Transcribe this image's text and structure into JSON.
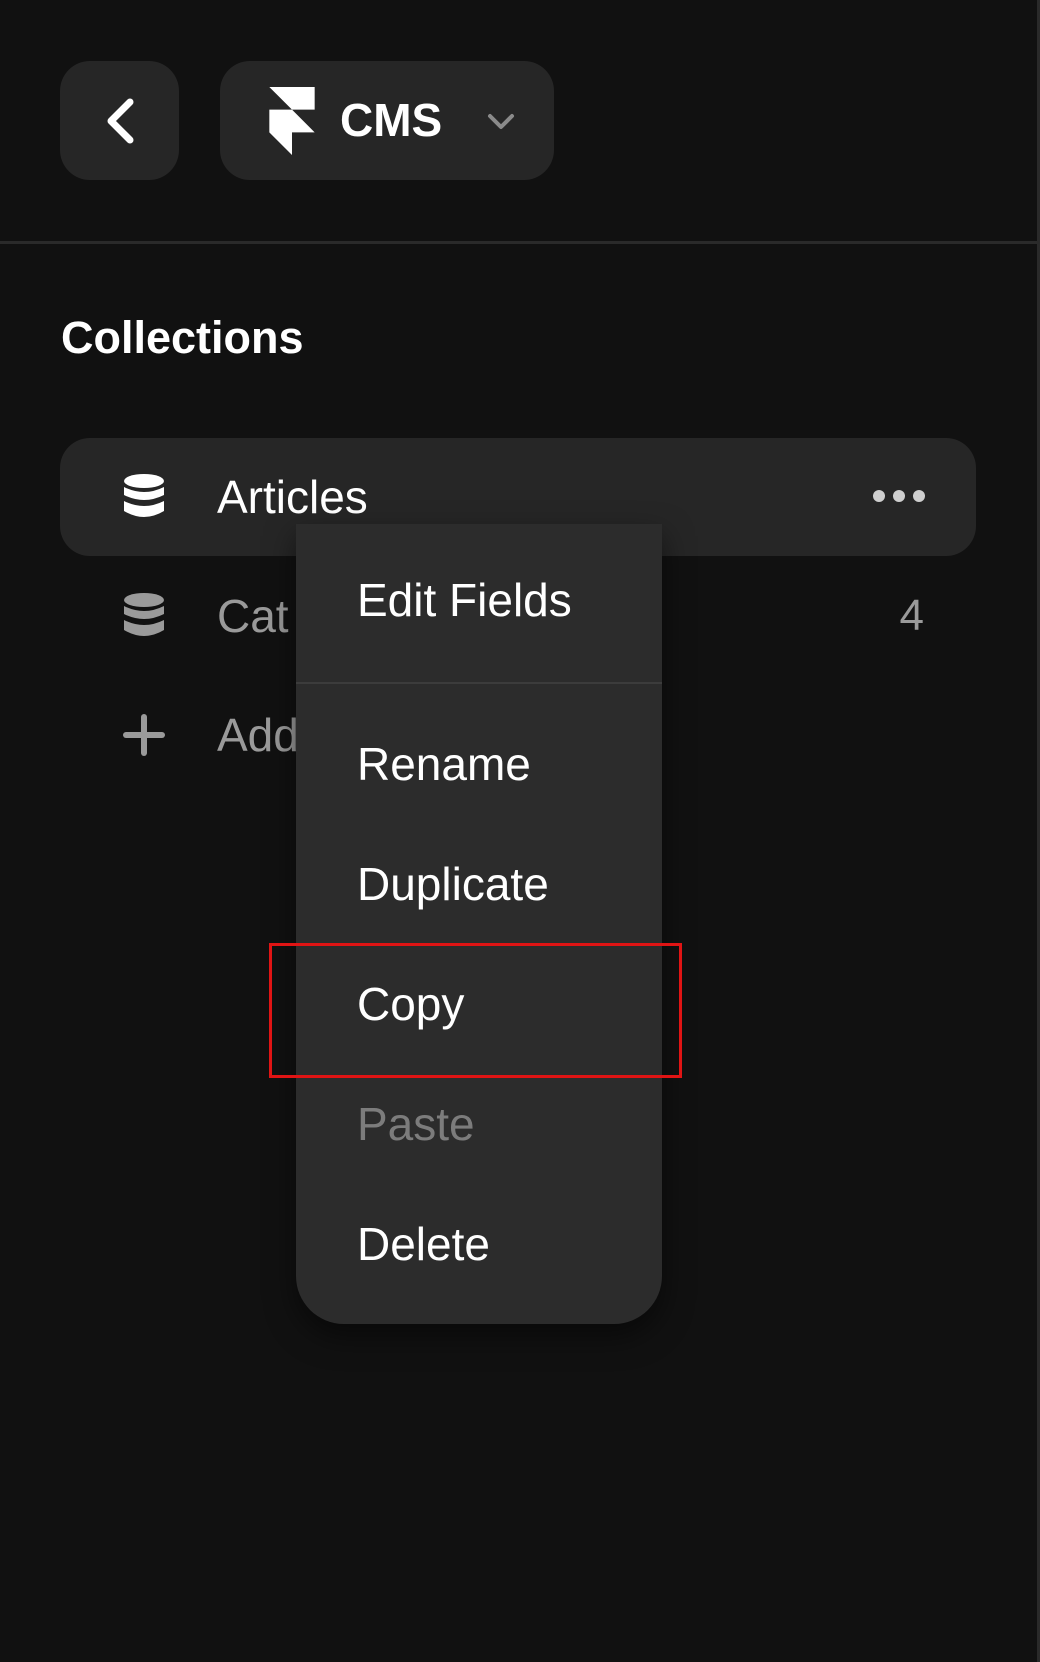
{
  "header": {
    "back_icon": "chevron-left-icon",
    "project": {
      "logo_icon": "framer-logo-icon",
      "label": "CMS",
      "dropdown_icon": "chevron-down-icon"
    }
  },
  "collections": {
    "title": "Collections",
    "items": [
      {
        "label": "Articles",
        "icon": "database-icon",
        "action_icon": "more-horizontal-icon",
        "active": true
      },
      {
        "label": "Cat",
        "icon": "database-icon",
        "count": "4",
        "active": false
      },
      {
        "label": "Add",
        "icon": "plus-icon",
        "active": false
      }
    ]
  },
  "context_menu": {
    "items": [
      {
        "label": "Edit Fields",
        "disabled": false
      },
      {
        "label": "Rename",
        "disabled": false
      },
      {
        "label": "Duplicate",
        "disabled": false
      },
      {
        "label": "Copy",
        "disabled": false,
        "highlighted": true
      },
      {
        "label": "Paste",
        "disabled": true
      },
      {
        "label": "Delete",
        "disabled": false
      }
    ]
  },
  "colors": {
    "background": "#111111",
    "surface": "#262626",
    "menu": "#2c2c2c",
    "text": "#ffffff",
    "muted_text": "#9a9a9a",
    "disabled_text": "#7c7c7c",
    "highlight": "#e01414"
  }
}
